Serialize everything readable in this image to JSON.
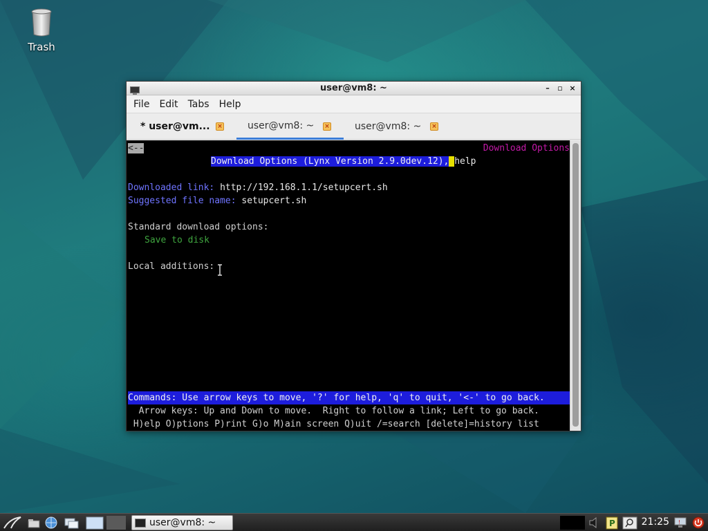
{
  "desktop": {
    "trash_label": "Trash"
  },
  "window": {
    "title": "user@vm8: ~",
    "controls": {
      "minimize": "–",
      "maximize": "▫",
      "close": "×"
    },
    "menu": [
      "File",
      "Edit",
      "Tabs",
      "Help"
    ],
    "tabs": [
      {
        "label": "* user@vm...",
        "bold": true,
        "active": false
      },
      {
        "label": "user@vm8: ~",
        "bold": false,
        "active": true
      },
      {
        "label": "user@vm8: ~",
        "bold": false,
        "active": false
      }
    ]
  },
  "terminal": {
    "back_button": "<--",
    "page_title_right": "Download Options",
    "header_highlight": "Download Options (Lynx Version 2.9.0dev.12),",
    "header_help": "help",
    "downloaded_link_label": "Downloaded link:",
    "downloaded_link_value": "http://192.168.1.1/setupcert.sh",
    "suggested_name_label": "Suggested file name:",
    "suggested_name_value": "setupcert.sh",
    "standard_options_heading": "Standard download options:",
    "save_to_disk": "Save to disk",
    "local_additions": "Local additions:",
    "commands_bar": "Commands: Use arrow keys to move, '?' for help, 'q' to quit, '<-' to go back.",
    "arrow_keys_help": "  Arrow keys: Up and Down to move.  Right to follow a link; Left to go back.",
    "shortcut_help": " H)elp O)ptions P)rint G)o M)ain screen Q)uit /=search [delete]=history list"
  },
  "taskbar": {
    "task_label": "user@vm8: ~",
    "clock": "21:25"
  },
  "colors": {
    "lynx_link_blue": "#6f74ff",
    "lynx_highlight_blue": "#1d1ddc",
    "lynx_green": "#3fa53f",
    "lynx_magenta": "#c41aa8",
    "cursor_yellow": "#e7e000",
    "active_tab_accent": "#3b7dd8"
  }
}
